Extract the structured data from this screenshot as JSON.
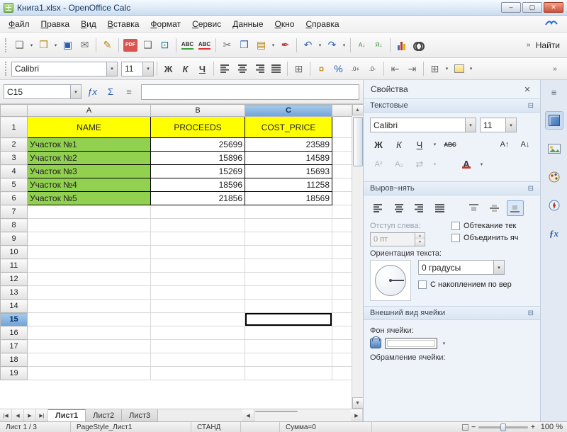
{
  "window": {
    "title": "Книга1.xlsx - OpenOffice Calc"
  },
  "menu": {
    "items": [
      "Файл",
      "Правка",
      "Вид",
      "Вставка",
      "Формат",
      "Сервис",
      "Данные",
      "Окно",
      "Справка"
    ]
  },
  "icons": {
    "minimize": "–",
    "maximize": "▢",
    "close": "✕",
    "new_document": "❏",
    "open": "❒",
    "save": "▣",
    "email": "✉",
    "edit_mode": "✎",
    "export_pdf": "PDF",
    "print": "❑",
    "page_preview": "⊡",
    "spellcheck": "ABC",
    "auto_spellcheck": "ABC",
    "cut": "✂",
    "copy": "❐",
    "paste": "▤",
    "format_paintbrush": "✒",
    "undo": "↶",
    "redo": "↷",
    "sort_ascending": "А↓",
    "sort_descending": "Я↓",
    "bold": "Ж",
    "italic": "К",
    "underline": "Ч",
    "currency": "¤",
    "percent": "%",
    "add_decimal": ".0+",
    "delete_decimal": ".0-",
    "indent_decrease": "⇤",
    "indent_increase": "⇥",
    "borders": "⊞",
    "dropdown": "▾",
    "overflow": "»",
    "spin_up": "▲",
    "spin_down": "▼",
    "scroll_up": "▲",
    "scroll_down": "▼",
    "scroll_left": "◀",
    "scroll_right": "▶",
    "tab_first": "|◀",
    "tab_prev": "◀",
    "tab_next": "▶",
    "tab_last": "▶|",
    "grow_font": "А↑",
    "shrink_font": "А↓",
    "superscript": "А²",
    "subscript": "А₂",
    "char_spacing": "⇄",
    "font_color": "А",
    "section_launcher": "⊟",
    "sidebar_menu": "≡"
  },
  "standard_toolbar": {
    "find_label": "Найти"
  },
  "formatting_toolbar": {
    "font_name": "Calibri",
    "font_size": "11"
  },
  "formula_bar": {
    "cell_reference": "C15",
    "fx": "ƒx",
    "sum": "Σ",
    "equals": "=",
    "input_value": ""
  },
  "grid": {
    "columns": [
      "A",
      "B",
      "C"
    ],
    "selected_column": "C",
    "selected_row": "15",
    "header_bg": "#FFFF00",
    "name_cell_bg": "#92D050",
    "rows": [
      {
        "n": "1",
        "a": "NAME",
        "b": "PROCEEDS",
        "c": "COST_PRICE"
      },
      {
        "n": "2",
        "a": "Участок №1",
        "b": "25699",
        "c": "23589"
      },
      {
        "n": "3",
        "a": "Участок №2",
        "b": "15896",
        "c": "14589"
      },
      {
        "n": "4",
        "a": "Участок №3",
        "b": "15269",
        "c": "15693"
      },
      {
        "n": "5",
        "a": "Участок №4",
        "b": "18596",
        "c": "11258"
      },
      {
        "n": "6",
        "a": "Участок №5",
        "b": "21856",
        "c": "18569"
      },
      {
        "n": "7"
      },
      {
        "n": "8"
      },
      {
        "n": "9"
      },
      {
        "n": "10"
      },
      {
        "n": "11"
      },
      {
        "n": "12"
      },
      {
        "n": "13"
      },
      {
        "n": "14"
      },
      {
        "n": "15"
      },
      {
        "n": "16"
      },
      {
        "n": "17"
      },
      {
        "n": "18"
      },
      {
        "n": "19"
      }
    ]
  },
  "sheet_tabs": {
    "tabs": [
      "Лист1",
      "Лист2",
      "Лист3"
    ],
    "active_tab": "Лист1"
  },
  "sidebar": {
    "title": "Свойства",
    "character": {
      "title": "Текстовые",
      "font_name": "Calibri",
      "font_size": "11",
      "strikethrough": "ABC"
    },
    "alignment": {
      "title": "Выров~нять",
      "indent_label": "Отступ слева:",
      "indent_value": "0 пт",
      "wrap_label": "Обтекание тек",
      "merge_label": "Объединить яч",
      "orientation_label": "Ориентация текста:",
      "degrees_value": "0 градусы",
      "stacked_label": "С накоплением по вер"
    },
    "cell_appearance": {
      "title": "Внешний вид ячейки",
      "background_label": "Фон ячейки:",
      "border_label": "Обрамление ячейки:"
    }
  },
  "status_bar": {
    "sheet_position": "Лист 1 / 3",
    "page_style": "PageStyle_Лист1",
    "selection_mode": "СТАНД",
    "sum": "Сумма=0",
    "zoom_level": "100 %"
  }
}
